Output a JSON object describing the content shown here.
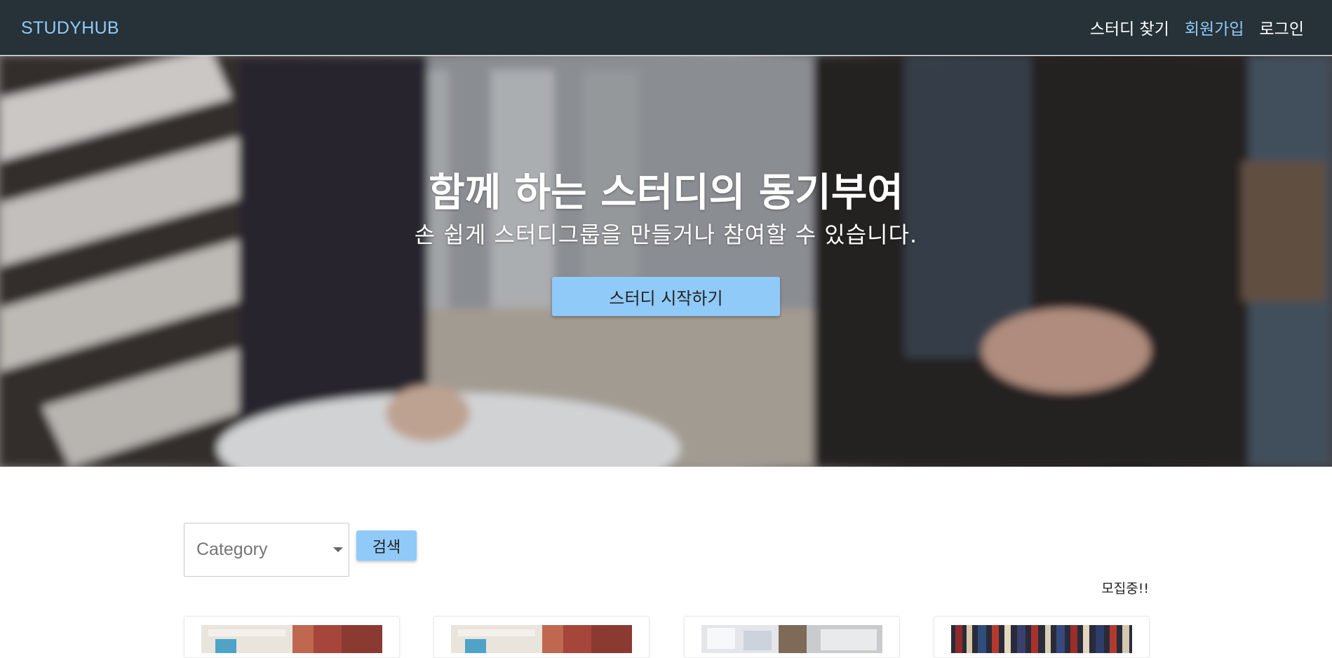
{
  "navbar": {
    "brand": "STUDYHUB",
    "links": [
      {
        "label": "스터디 찾기",
        "active": false
      },
      {
        "label": "회원가입",
        "active": true
      },
      {
        "label": "로그인",
        "active": false
      }
    ],
    "accent_color": "#90caf9",
    "background_color": "#263238"
  },
  "hero": {
    "title": "함께 하는 스터디의 동기부여",
    "subtitle": "손 쉽게 스터디그룹을 만들거나 참여할 수 있습니다.",
    "cta_label": "스터디 시작하기"
  },
  "search": {
    "category_value": "Category",
    "button_label": "검색"
  },
  "list": {
    "status_label": "모집중!!",
    "cards": [
      {
        "image": "keyboard-desk-photo"
      },
      {
        "image": "keyboard-desk-photo"
      },
      {
        "image": "laptop-documents-photo"
      },
      {
        "image": "bookshelf-photo"
      }
    ]
  }
}
